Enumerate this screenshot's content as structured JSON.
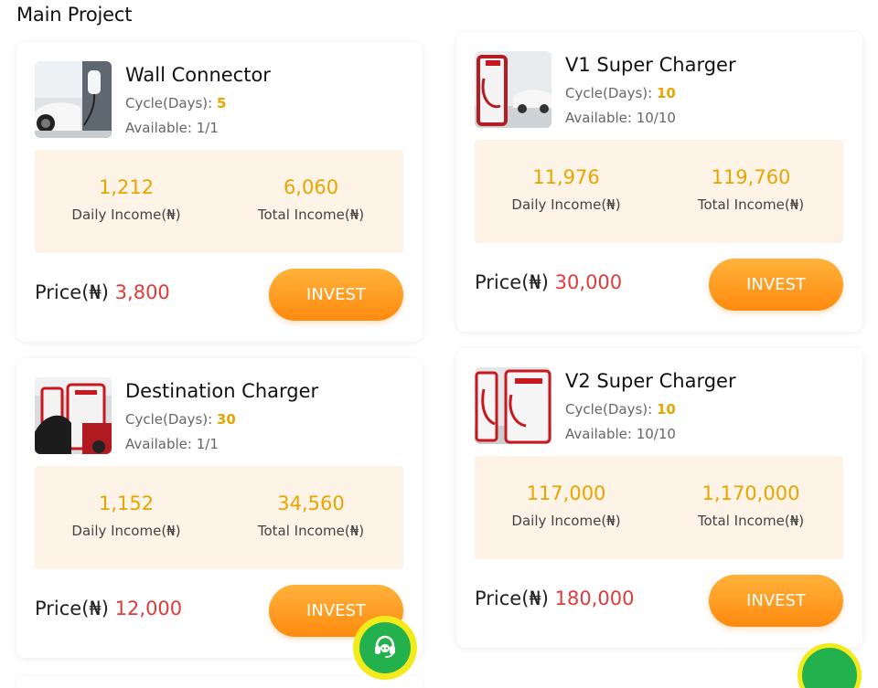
{
  "section": {
    "title": "Main Project"
  },
  "currency_symbol": "₦",
  "colors": {
    "accent_yellow": "#e8a500",
    "price_red": "#e03b3b",
    "income_bg": "#fdf3e6",
    "button_orange_top": "#ffb23a",
    "button_orange_bottom": "#ff8a10",
    "support_green": "#22b14c",
    "support_ring": "#f3ea1c"
  },
  "products": [
    {
      "name": "Wall Connector",
      "cycle_label": "Cycle(Days):",
      "cycle_value": "5",
      "available": "Available: 1/1",
      "daily_income": "1,212",
      "daily_label": "Daily Income(₦)",
      "total_income": "6,060",
      "total_label": "Total Income(₦)",
      "price_label": "Price(₦)",
      "price_value": "3,800",
      "button": "INVEST",
      "image_icon": "wall-connector-image"
    },
    {
      "name": "V1 Super Charger",
      "cycle_label": "Cycle(Days):",
      "cycle_value": "10",
      "available": "Available: 10/10",
      "daily_income": "11,976",
      "daily_label": "Daily Income(₦)",
      "total_income": "119,760",
      "total_label": "Total Income(₦)",
      "price_label": "Price(₦)",
      "price_value": "30,000",
      "button": "INVEST",
      "image_icon": "v1-supercharger-image"
    },
    {
      "name": "Destination Charger",
      "cycle_label": "Cycle(Days):",
      "cycle_value": "30",
      "available": "Available: 1/1",
      "daily_income": "1,152",
      "daily_label": "Daily Income(₦)",
      "total_income": "34,560",
      "total_label": "Total Income(₦)",
      "price_label": "Price(₦)",
      "price_value": "12,000",
      "button": "INVEST",
      "image_icon": "destination-charger-image"
    },
    {
      "name": "V2 Super Charger",
      "cycle_label": "Cycle(Days):",
      "cycle_value": "10",
      "available": "Available: 10/10",
      "daily_income": "117,000",
      "daily_label": "Daily Income(₦)",
      "total_income": "1,170,000",
      "total_label": "Total Income(₦)",
      "price_label": "Price(₦)",
      "price_value": "180,000",
      "button": "INVEST",
      "image_icon": "v2-supercharger-image"
    }
  ],
  "support": {
    "icon": "customer-service-headset-icon"
  }
}
